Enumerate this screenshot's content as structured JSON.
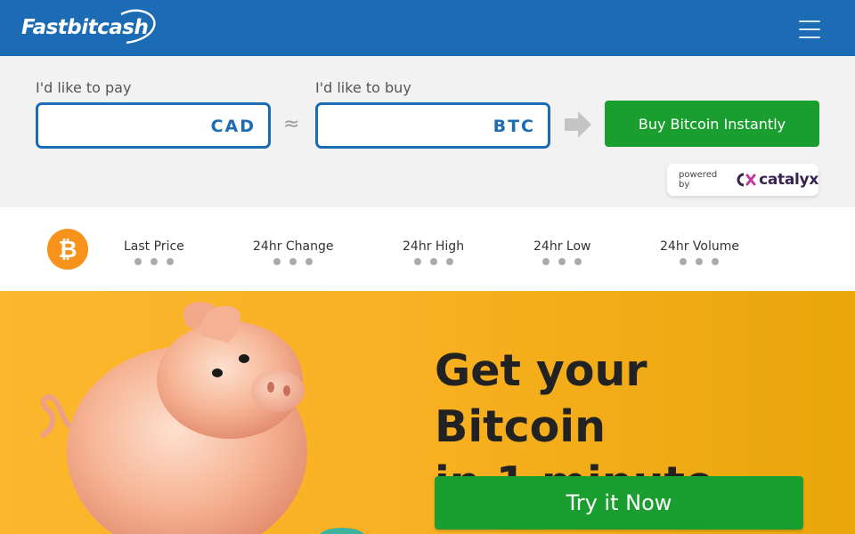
{
  "header": {
    "logo_text": "Fastbitcash",
    "menu_icon": "hamburger-menu-icon",
    "bg_color": "#1c6bb5"
  },
  "converter": {
    "pay_label": "I'd like to pay",
    "pay_value": "",
    "pay_currency": "CAD",
    "approx_symbol": "≈",
    "buy_label": "I'd like to buy",
    "buy_value": "",
    "buy_currency": "BTC",
    "arrow_icon": "arrow-right-icon",
    "buy_button_label": "Buy Bitcoin Instantly",
    "powered_by": "powered by",
    "powered_brand": "catalyx"
  },
  "ticker": {
    "coin_symbol": "₿",
    "stats": [
      {
        "label": "Last Price"
      },
      {
        "label": "24hr Change"
      },
      {
        "label": "24hr High"
      },
      {
        "label": "24hr Low"
      },
      {
        "label": "24hr Volume"
      }
    ]
  },
  "hero": {
    "title_line1": "Get your Bitcoin",
    "title_line2": "in 1 minute",
    "cta_label": "Try it Now",
    "image": "piggy-bank-illustration"
  },
  "colors": {
    "brand_blue": "#1c6bb5",
    "cta_green": "#1a9e2f",
    "bitcoin_orange": "#f7931a",
    "hero_yellow": "#fbb72d"
  }
}
